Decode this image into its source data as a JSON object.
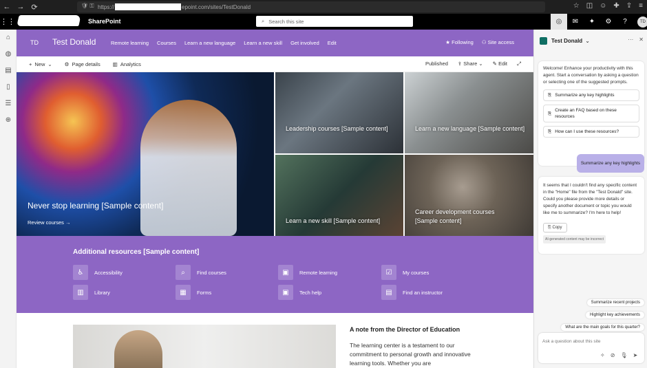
{
  "browser": {
    "url_prefix": "https://",
    "url_suffix": "epoint.com/sites/TestDonald"
  },
  "suite": {
    "app_name": "SharePoint",
    "search_placeholder": "Search this site",
    "user_initials": "TD"
  },
  "site": {
    "logo": "TD",
    "title": "Test Donald",
    "nav": [
      "Remote learning",
      "Courses",
      "Learn a new language",
      "Learn a new skill",
      "Get involved",
      "Edit"
    ],
    "following": "Following",
    "site_access": "Site access"
  },
  "command_bar": {
    "new": "New",
    "page_details": "Page details",
    "analytics": "Analytics",
    "published": "Published",
    "share": "Share",
    "edit": "Edit"
  },
  "hero": {
    "main_title": "Never stop learning [Sample content]",
    "main_cta": "Review courses",
    "tiles": [
      {
        "title": "Leadership courses [Sample content]"
      },
      {
        "title": "Learn a new language [Sample content]"
      },
      {
        "title": "Learn a new skill [Sample content]"
      },
      {
        "title": "Career development courses [Sample content]"
      }
    ]
  },
  "resources": {
    "title": "Additional resources [Sample content]",
    "items": [
      {
        "label": "Accessibility",
        "icon": "accessibility-icon"
      },
      {
        "label": "Find courses",
        "icon": "search-icon"
      },
      {
        "label": "Remote learning",
        "icon": "remote-learning-icon"
      },
      {
        "label": "My courses",
        "icon": "checklist-icon"
      },
      {
        "label": "Library",
        "icon": "library-icon"
      },
      {
        "label": "Forms",
        "icon": "forms-icon"
      },
      {
        "label": "Tech help",
        "icon": "tech-help-icon"
      },
      {
        "label": "Find an instructor",
        "icon": "document-icon"
      }
    ]
  },
  "note": {
    "title": "A note from the Director of Education",
    "text": "The learning center is a testament to our commitment to personal growth and innovative learning tools. Whether you are"
  },
  "copilot": {
    "agent_name": "Test Donald",
    "welcome": "Welcome! Enhance your productivity with this agent. Start a conversation by asking a question or selecting one of the suggested prompts.",
    "prompts": [
      "Summarize any key highlights",
      "Create an FAQ based on these resources",
      "How can I use these resources?"
    ],
    "user_message": "Summarize any key highlights",
    "reply": "It seems that I couldn't find any specific content in the \"Home\" file from the \"Test Donald\" site. Could you please provide more details or specify another document or topic you would like me to summarize? I'm here to help!",
    "copy": "Copy",
    "disclaimer": "AI-generated content may be incorrect",
    "suggestions": [
      "Summarize recent projects",
      "Highlight key achievements",
      "What are the main goals for this quarter?"
    ],
    "ask_placeholder": "Ask a question about this site"
  }
}
